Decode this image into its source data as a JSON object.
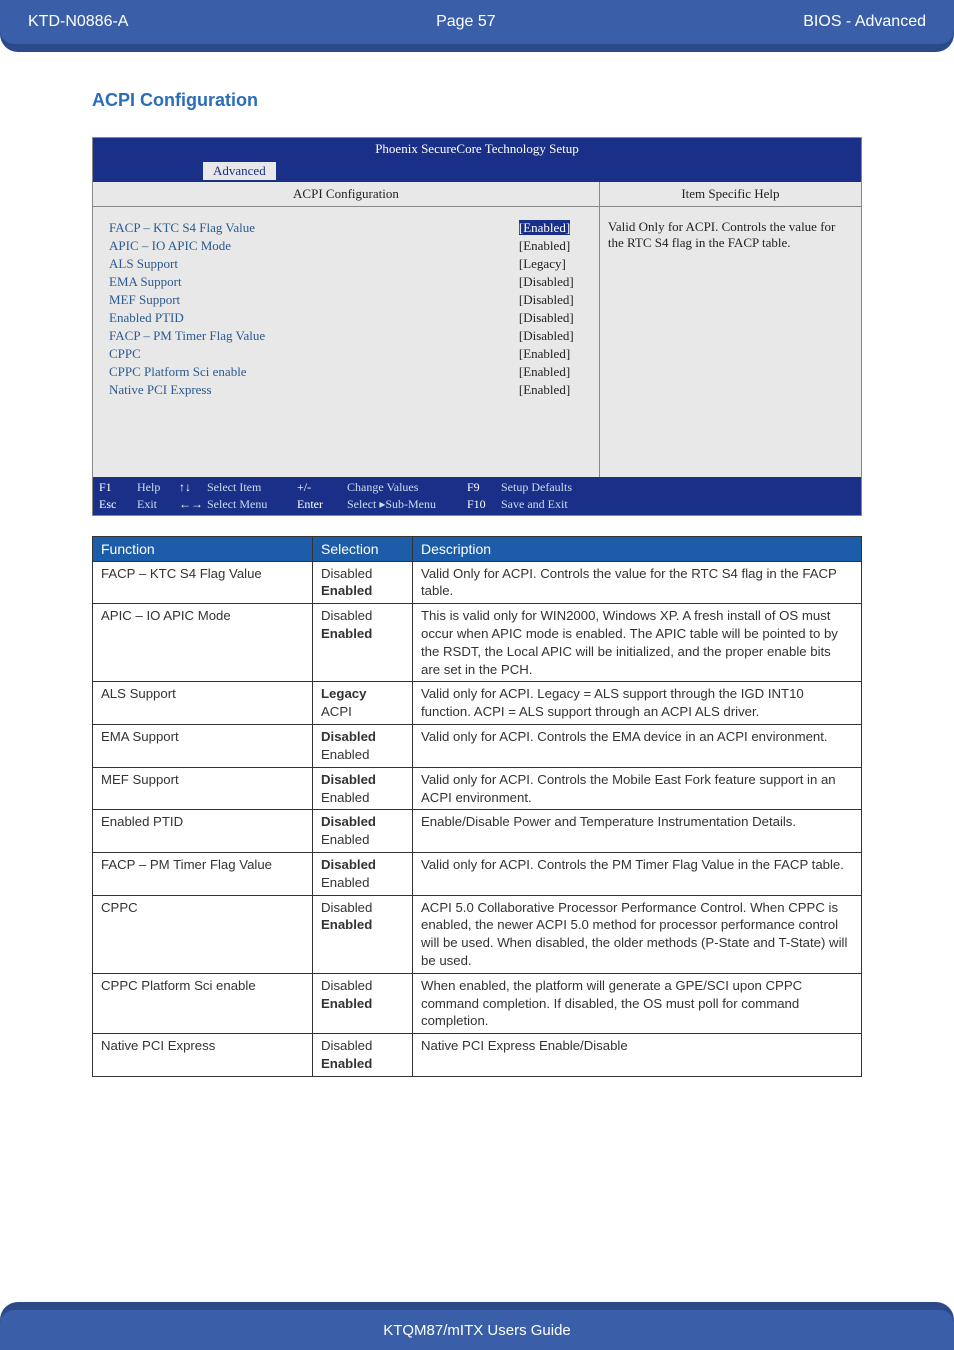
{
  "header": {
    "left": "KTD-N0886-A",
    "center": "Page 57",
    "right": "BIOS  - Advanced"
  },
  "section_title": "ACPI Configuration",
  "bios": {
    "title": "Phoenix SecureCore Technology Setup",
    "tab": "Advanced",
    "left_title": "ACPI Configuration",
    "right_title": "Item Specific Help",
    "items": [
      {
        "label": "FACP – KTC S4 Flag Value",
        "value": "[Enabled]",
        "selected": true
      },
      {
        "label": "APIC – IO APIC Mode",
        "value": "[Enabled]"
      },
      {
        "label": "ALS Support",
        "value": "[Legacy]"
      },
      {
        "label": "EMA Support",
        "value": "[Disabled]"
      },
      {
        "label": "MEF Support",
        "value": "[Disabled]"
      },
      {
        "label": "Enabled PTID",
        "value": "[Disabled]"
      },
      {
        "label": "FACP – PM Timer Flag Value",
        "value": "[Disabled]"
      },
      {
        "label": "CPPC",
        "value": "[Enabled]"
      },
      {
        "label": "CPPC Platform Sci enable",
        "value": "[Enabled]"
      },
      {
        "label": "Native PCI Express",
        "value": "[Enabled]"
      }
    ],
    "help": "Valid Only for ACPI. Controls the value for the RTC S4 flag in the FACP table.",
    "keys": {
      "r1": [
        "F1",
        "Help",
        "↑↓",
        "Select Item",
        "+/-",
        "Change Values",
        "F9",
        "Setup Defaults"
      ],
      "r2": [
        "Esc",
        "Exit",
        "←→",
        "Select Menu",
        "Enter",
        "Select ▸Sub-Menu",
        "F10",
        "Save and Exit"
      ]
    }
  },
  "table": {
    "headers": [
      "Function",
      "Selection",
      "Description"
    ],
    "rows": [
      {
        "func": "FACP – KTC S4 Flag Value",
        "sel": [
          "Disabled",
          "Enabled"
        ],
        "bold": [
          false,
          true
        ],
        "desc": "Valid Only for ACPI. Controls the value for the RTC S4 flag in the FACP table."
      },
      {
        "func": "APIC – IO APIC Mode",
        "sel": [
          "Disabled",
          "Enabled"
        ],
        "bold": [
          false,
          true
        ],
        "desc": "This is valid only for WIN2000, Windows XP. A fresh install of OS must occur when APIC mode is enabled. The APIC table will be pointed to by the RSDT, the Local APIC will be initialized, and the proper enable bits are set in the PCH."
      },
      {
        "func": "ALS Support",
        "sel": [
          "Legacy",
          "ACPI"
        ],
        "bold": [
          true,
          false
        ],
        "desc": "Valid only for ACPI. Legacy = ALS support through the IGD INT10 function. ACPI = ALS support through an ACPI ALS driver."
      },
      {
        "func": "EMA Support",
        "sel": [
          "Disabled",
          "Enabled"
        ],
        "bold": [
          true,
          false
        ],
        "desc": "Valid only for ACPI. Controls the EMA device in an ACPI environment."
      },
      {
        "func": "MEF Support",
        "sel": [
          "Disabled",
          "Enabled"
        ],
        "bold": [
          true,
          false
        ],
        "desc": "Valid only for ACPI. Controls the Mobile East Fork feature support in an ACPI environment."
      },
      {
        "func": "Enabled PTID",
        "sel": [
          "Disabled",
          "Enabled"
        ],
        "bold": [
          true,
          false
        ],
        "desc": "Enable/Disable Power and Temperature Instrumentation Details."
      },
      {
        "func": "FACP – PM Timer Flag Value",
        "sel": [
          "Disabled",
          "Enabled"
        ],
        "bold": [
          true,
          false
        ],
        "desc": "Valid only for ACPI. Controls the PM Timer Flag Value in the FACP table."
      },
      {
        "func": "CPPC",
        "sel": [
          "Disabled",
          "Enabled"
        ],
        "bold": [
          false,
          true
        ],
        "desc": "ACPI 5.0 Collaborative Processor Performance Control. When CPPC is enabled, the newer ACPI 5.0 method for processor performance control will be used. When disabled, the older methods (P-State and T-State) will be used."
      },
      {
        "func": "CPPC Platform Sci enable",
        "sel": [
          "Disabled",
          "Enabled"
        ],
        "bold": [
          false,
          true
        ],
        "desc": "When enabled, the platform will generate a GPE/SCI upon CPPC command completion. If disabled, the OS must poll for command completion."
      },
      {
        "func": "Native PCI Express",
        "sel": [
          "Disabled",
          "Enabled"
        ],
        "bold": [
          false,
          true
        ],
        "desc": "Native PCI Express Enable/Disable"
      }
    ]
  },
  "footer": "KTQM87/mITX Users Guide"
}
